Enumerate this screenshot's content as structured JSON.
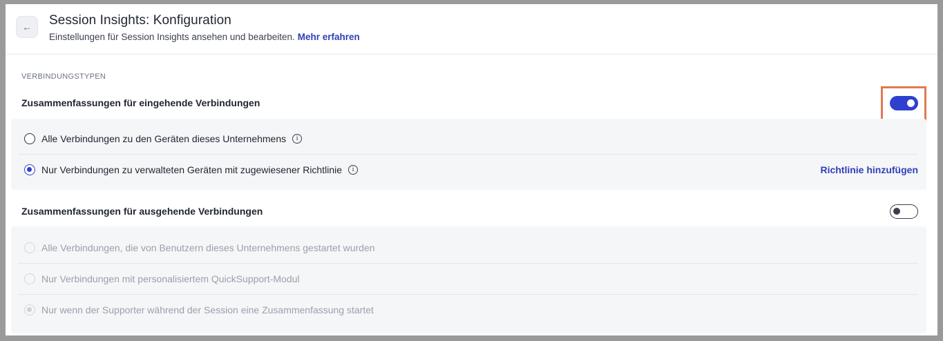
{
  "header": {
    "back_icon": "arrow-left-icon",
    "title": "Session Insights: Konfiguration",
    "subtitle": "Einstellungen für Session Insights ansehen und bearbeiten.",
    "learn_more": "Mehr erfahren"
  },
  "section": {
    "label": "VERBINDUNGSTYPEN"
  },
  "incoming": {
    "title": "Zusammenfassungen für eingehende Verbindungen",
    "toggle_on": true,
    "options": [
      {
        "label": "Alle Verbindungen zu den Geräten dieses Unternehmens",
        "checked": false
      },
      {
        "label": "Nur Verbindungen zu verwalteten Geräten mit zugewiesener Richtlinie",
        "checked": true
      }
    ],
    "add_policy": "Richtlinie hinzufügen"
  },
  "outgoing": {
    "title": "Zusammenfassungen für ausgehende Verbindungen",
    "toggle_on": false,
    "options": [
      {
        "label": "Alle Verbindungen, die von Benutzern dieses Unternehmens gestartet wurden",
        "checked": false
      },
      {
        "label": "Nur Verbindungen mit personalisiertem QuickSupport-Modul",
        "checked": false
      },
      {
        "label": "Nur wenn der Supporter während der Session eine Zusammenfassung startet",
        "checked": true
      }
    ]
  },
  "colors": {
    "accent": "#2f3fcf",
    "link": "#2f3fb8",
    "highlight": "#e07a4f"
  }
}
